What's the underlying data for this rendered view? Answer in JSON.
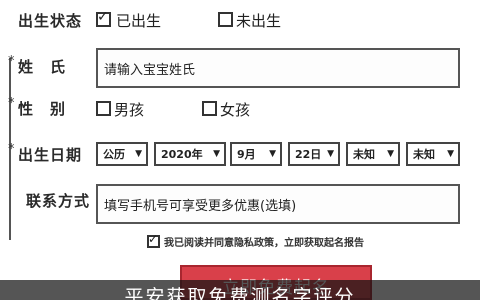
{
  "form": {
    "birth_status": {
      "label": "出生状态",
      "options": [
        {
          "label": "已出生",
          "checked": true
        },
        {
          "label": "未出生",
          "checked": false
        }
      ]
    },
    "surname": {
      "required_mark": "*",
      "label": "姓　氏",
      "placeholder": "请输入宝宝姓氏"
    },
    "gender": {
      "required_mark": "*",
      "label": "性　别",
      "options": [
        {
          "label": "男孩",
          "checked": false
        },
        {
          "label": "女孩",
          "checked": false
        }
      ]
    },
    "birth_date": {
      "required_mark": "*",
      "label": "出生日期",
      "selects": [
        "公历",
        "2020年",
        "9月",
        "22日",
        "未知",
        "未知"
      ]
    },
    "contact": {
      "label": "联系方式",
      "placeholder": "填写手机号可享受更多优惠(选填)"
    },
    "agreement": {
      "checked": true,
      "text": "我已阅读并同意隐私政策，立即获取起名报告"
    },
    "submit_label": "立即免费起名"
  },
  "banner": {
    "text": "平安获取免费测名字评分"
  },
  "colors": {
    "submit_bg": "#d9404a",
    "banner_bg": "#141414"
  }
}
